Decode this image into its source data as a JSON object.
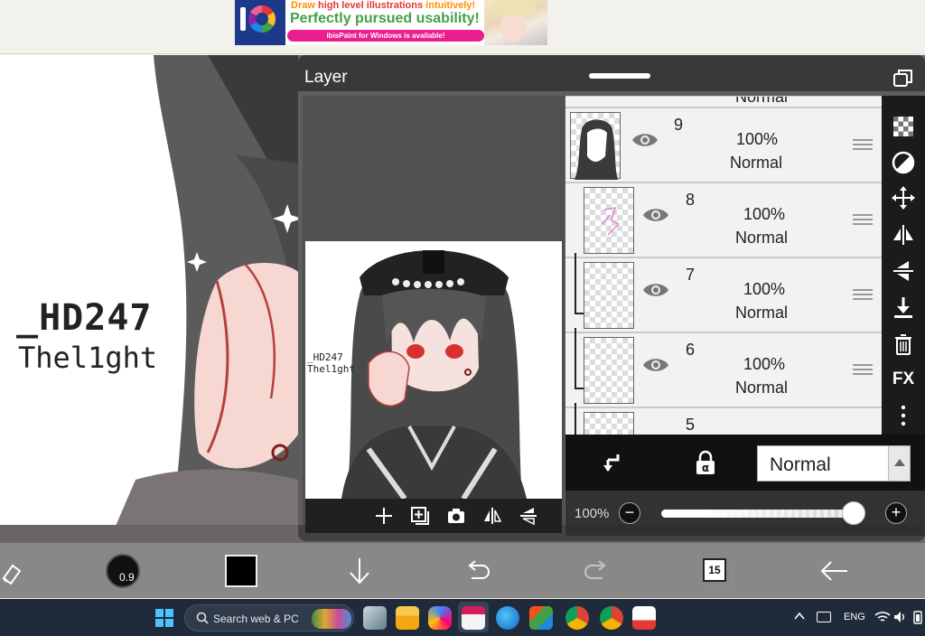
{
  "ad": {
    "line1_prefix": "Draw ",
    "line1_highlight": "high level illustrations",
    "line1_suffix": " intuitively!",
    "line2": "Perfectly pursued usability!",
    "line3": "ibisPaint for Windows is available!"
  },
  "canvas": {
    "signature_line1": "_HD247",
    "signature_line2": "Thel1ght"
  },
  "layer_panel": {
    "title": "Layer",
    "thumbnail_signature_line1": "_HD247",
    "thumbnail_signature_line2": "Thel1ght",
    "partial_top_mode": "Normal",
    "layers": [
      {
        "number": "9",
        "opacity": "100%",
        "mode": "Normal"
      },
      {
        "number": "8",
        "opacity": "100%",
        "mode": "Normal"
      },
      {
        "number": "7",
        "opacity": "100%",
        "mode": "Normal"
      },
      {
        "number": "6",
        "opacity": "100%",
        "mode": "Normal"
      },
      {
        "number": "5",
        "opacity": "",
        "mode": ""
      }
    ],
    "tools": [
      "checker-icon",
      "fill-invert-icon",
      "move-icon",
      "flip-horizontal-icon",
      "flip-vertical-icon",
      "merge-down-icon",
      "trash-icon",
      "FX",
      "more-icon"
    ],
    "blend_mode": "Normal",
    "opacity_label": "100%",
    "opacity_value": 1.0
  },
  "toolbar": {
    "brush_size": "0.9",
    "color": "#000000",
    "layer_count": "15"
  },
  "taskbar": {
    "search_placeholder": "Search web & PC",
    "language": "ENG"
  },
  "colors": {
    "panel_bg": "#1b1b1b",
    "accent_taskbar": "#1f2a3a",
    "brand_green": "#43a047"
  }
}
